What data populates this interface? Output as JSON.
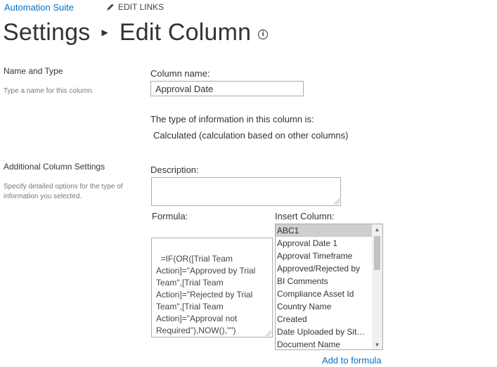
{
  "header": {
    "site_link": "Automation Suite",
    "edit_links": "EDIT LINKS",
    "breadcrumb_parent": "Settings",
    "breadcrumb_current": "Edit Column",
    "info_icon": "info-icon"
  },
  "name_type_section": {
    "title": "Name and Type",
    "description": "Type a name for this column.",
    "column_name_label": "Column name:",
    "column_name_value": "Approval Date",
    "type_label": "The type of information in this column is:",
    "type_value": "Calculated (calculation based on other columns)"
  },
  "additional_section": {
    "title": "Additional Column Settings",
    "description": "Specify detailed options for the type of information you selected.",
    "description_label": "Description:",
    "description_value": "",
    "formula_label": "Formula:",
    "formula_value": "=IF(OR([Trial Team Action]=\"Approved by Trial Team\",[Trial Team Action]=\"Rejected by Trial Team\",[Trial Team Action]=\"Approval not Required\"),NOW(),\"\")",
    "insert_column_label": "Insert Column:",
    "insert_column_items": [
      "ABC1",
      "Approval Date 1",
      "Approval Timeframe",
      "Approved/Rejected by",
      "BI Comments",
      "Compliance Asset Id",
      "Country Name",
      "Created",
      "Date Uploaded by Sit…",
      "Document Name"
    ],
    "selected_item": "ABC1",
    "add_to_formula": "Add to formula"
  },
  "icons": [
    "pencil-icon",
    "breadcrumb-arrow-icon",
    "info-icon",
    "scroll-up-icon",
    "scroll-down-icon"
  ]
}
